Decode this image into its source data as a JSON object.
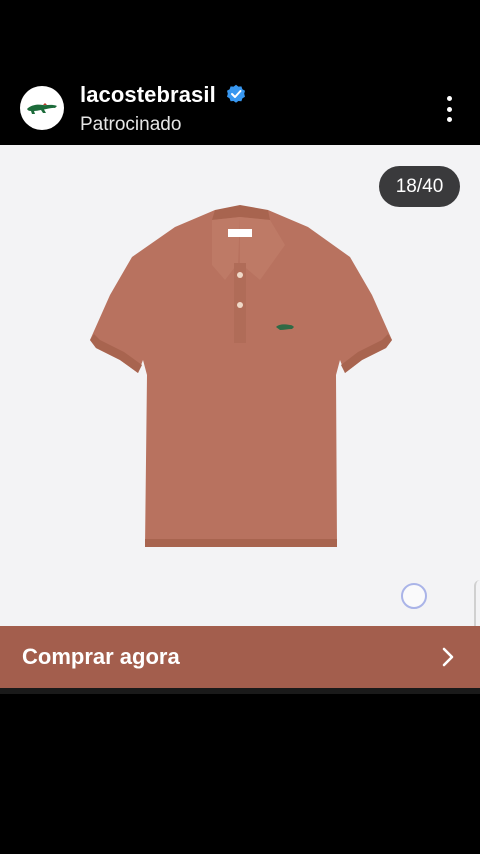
{
  "post": {
    "username": "lacostebrasil",
    "sponsored_label": "Patrocinado",
    "verified_icon": "verified-badge-icon",
    "more_icon": "more-vertical-icon",
    "brand_logo_icon": "crocodile-logo-icon"
  },
  "media": {
    "counter": "18/40",
    "product_color": "#b8725f",
    "background_color": "#f3f3f5"
  },
  "cta": {
    "label": "Comprar agora",
    "icon": "chevron-right-icon",
    "color": "#a35e4d"
  }
}
